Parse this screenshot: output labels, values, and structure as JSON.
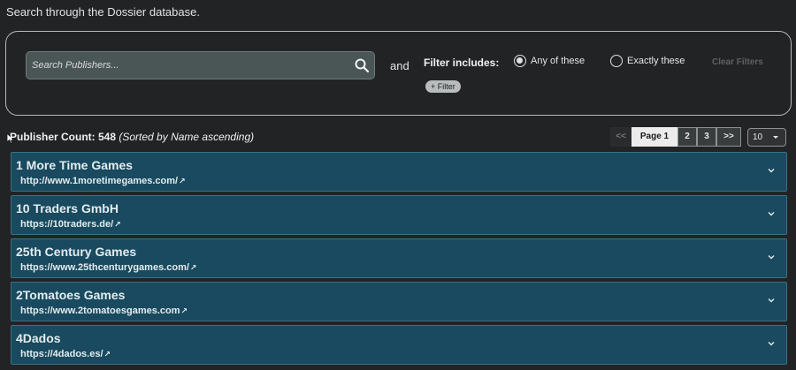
{
  "intro": "Search through the Dossier database.",
  "search": {
    "placeholder": "Search Publishers..."
  },
  "filters": {
    "and_label": "and",
    "label": "Filter includes:",
    "options": [
      "Any of these",
      "Exactly these"
    ],
    "selected": "Any of these",
    "clear_label": "Clear Filters",
    "add_label": "+ Filter"
  },
  "results": {
    "count_label": "Publisher Count: 548",
    "sort_label": "(Sorted by Name ascending)"
  },
  "pagination": {
    "prev": "<<",
    "current": "Page 1",
    "pages": [
      "2",
      "3"
    ],
    "next": ">>",
    "per_page": "10"
  },
  "publishers": [
    {
      "name": "1 More Time Games",
      "url": "http://www.1moretimegames.com/"
    },
    {
      "name": "10 Traders GmbH",
      "url": "https://10traders.de/"
    },
    {
      "name": "25th Century Games",
      "url": "https://www.25thcenturygames.com/"
    },
    {
      "name": "2Tomatoes Games",
      "url": "https://www.2tomatoesgames.com"
    },
    {
      "name": "4Dados",
      "url": "https://4dados.es/"
    }
  ],
  "icons": {
    "search": "search-icon",
    "external": "external-link-icon",
    "expand": "chevron-down-icon"
  }
}
